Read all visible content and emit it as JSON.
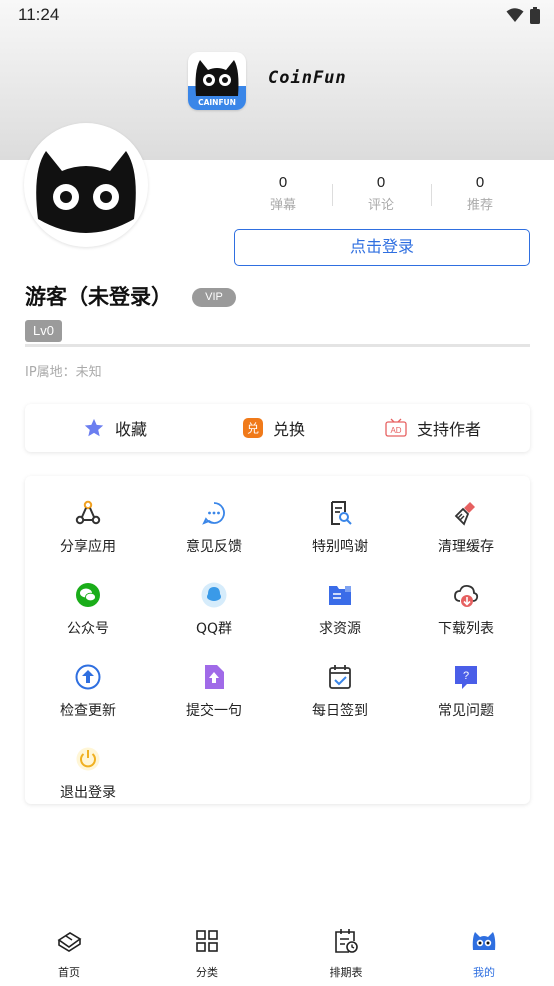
{
  "status_bar": {
    "time": "11:24"
  },
  "app": {
    "logo_text": "CoinFun",
    "logo_badge": "CAINFUN"
  },
  "stats": [
    {
      "value": "0",
      "label": "弹幕"
    },
    {
      "value": "0",
      "label": "评论"
    },
    {
      "value": "0",
      "label": "推荐"
    }
  ],
  "login_button": "点击登录",
  "user": {
    "name": "游客（未登录）",
    "vip": "VIP",
    "level": "Lv0",
    "ip": "IP属地：未知"
  },
  "actions": [
    {
      "label": "收藏",
      "icon": "star-icon"
    },
    {
      "label": "兑换",
      "icon": "exchange-icon"
    },
    {
      "label": "支持作者",
      "icon": "ad-icon"
    }
  ],
  "grid": [
    {
      "label": "分享应用",
      "icon": "share-icon"
    },
    {
      "label": "意见反馈",
      "icon": "feedback-icon"
    },
    {
      "label": "特别鸣谢",
      "icon": "thanks-icon"
    },
    {
      "label": "清理缓存",
      "icon": "broom-icon"
    },
    {
      "label": "公众号",
      "icon": "wechat-icon"
    },
    {
      "label": "QQ群",
      "icon": "qq-icon"
    },
    {
      "label": "求资源",
      "icon": "folder-icon"
    },
    {
      "label": "下载列表",
      "icon": "cloud-download-icon"
    },
    {
      "label": "检查更新",
      "icon": "update-icon"
    },
    {
      "label": "提交一句",
      "icon": "submit-icon"
    },
    {
      "label": "每日签到",
      "icon": "calendar-check-icon"
    },
    {
      "label": "常见问题",
      "icon": "question-icon"
    },
    {
      "label": "退出登录",
      "icon": "power-icon"
    }
  ],
  "bottom_nav": [
    {
      "label": "首页",
      "icon": "home-tv-icon"
    },
    {
      "label": "分类",
      "icon": "category-grid-icon"
    },
    {
      "label": "排期表",
      "icon": "schedule-icon"
    },
    {
      "label": "我的",
      "icon": "mine-cat-icon",
      "active": true
    }
  ],
  "colors": {
    "accent": "#2f6fe0",
    "badge_gray": "#9b9b9b",
    "star": "#6b7ef0",
    "exchange": "#f07a1a",
    "ad": "#e66060"
  }
}
